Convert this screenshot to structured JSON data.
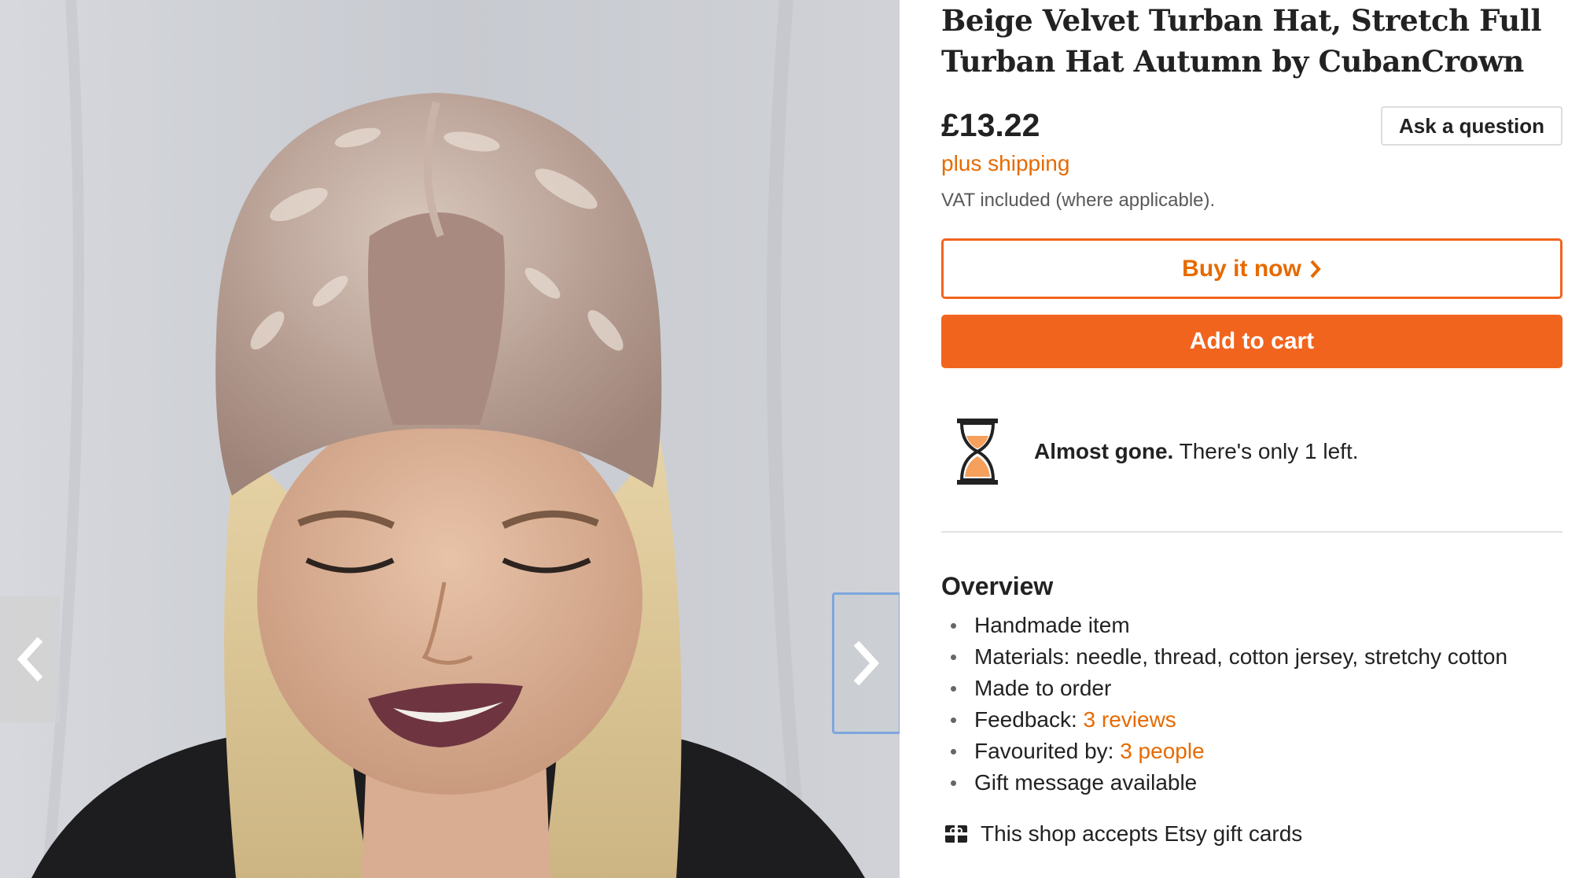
{
  "listing": {
    "title": "Beige Velvet Turban Hat, Stretch Full Turban Hat Autumn by CubanCrown",
    "price": "£13.22",
    "shipping_link": "plus shipping",
    "vat_note": "VAT included (where applicable).",
    "ask_label": "Ask a question",
    "buy_now_label": "Buy it now",
    "add_to_cart_label": "Add to cart"
  },
  "scarcity": {
    "bold": "Almost gone.",
    "text": " There's only 1 left."
  },
  "overview": {
    "title": "Overview",
    "items": {
      "handmade": "Handmade item",
      "materials": "Materials: needle, thread, cotton jersey, stretchy cotton",
      "made_to_order": "Made to order",
      "feedback_label": "Feedback: ",
      "feedback_link": "3 reviews",
      "favourited_label": "Favourited by: ",
      "favourited_link": "3 people",
      "gift_message": "Gift message available"
    }
  },
  "giftcards": {
    "text": "This shop accepts Etsy gift cards"
  },
  "icons": {
    "prev": "chevron-left-icon",
    "next": "chevron-right-icon",
    "buy_arrow": "chevron-right-icon",
    "scarcity": "hourglass-icon",
    "giftcard": "gift-card-icon"
  },
  "colors": {
    "accent": "#f1641e",
    "accent_text": "#e66a00",
    "text": "#222222",
    "muted": "#595959"
  }
}
